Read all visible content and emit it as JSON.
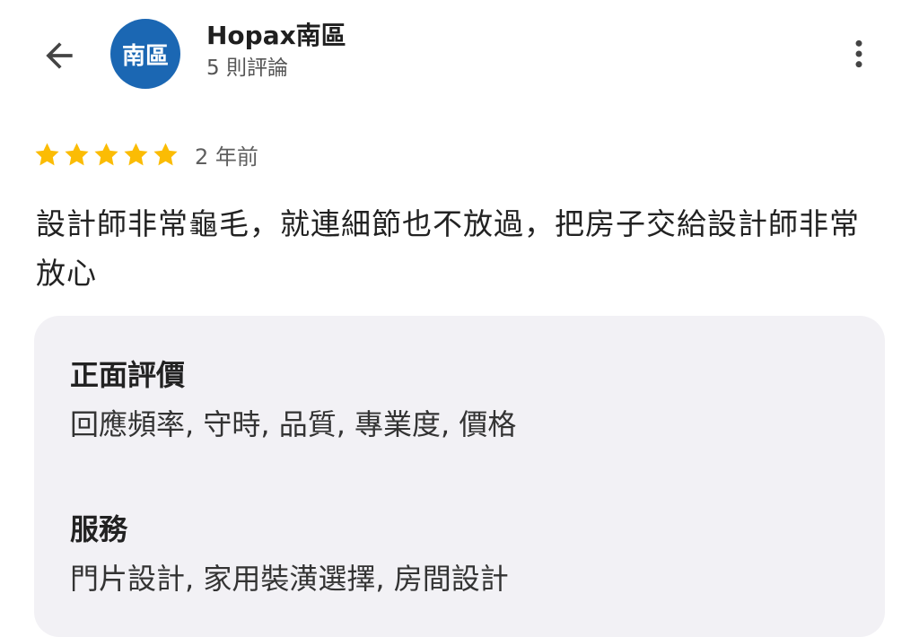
{
  "header": {
    "back_icon": "arrow-back-icon",
    "avatar_text": "南區",
    "avatar_color": "#1b67b3",
    "title": "Hopax南區",
    "subtitle": "5 則評論",
    "more_icon": "more-vertical-icon"
  },
  "review": {
    "rating": 5,
    "rating_max": 5,
    "star_color": "#fbbc04",
    "time_ago": "2 年前",
    "text": "設計師非常龜毛，就連細節也不放過，把房子交給設計師非常放心"
  },
  "attributes": [
    {
      "heading": "正面評價",
      "values": "回應頻率, 守時, 品質, 專業度, 價格"
    },
    {
      "heading": "服務",
      "values": "門片設計, 家用裝潢選擇, 房間設計"
    }
  ]
}
